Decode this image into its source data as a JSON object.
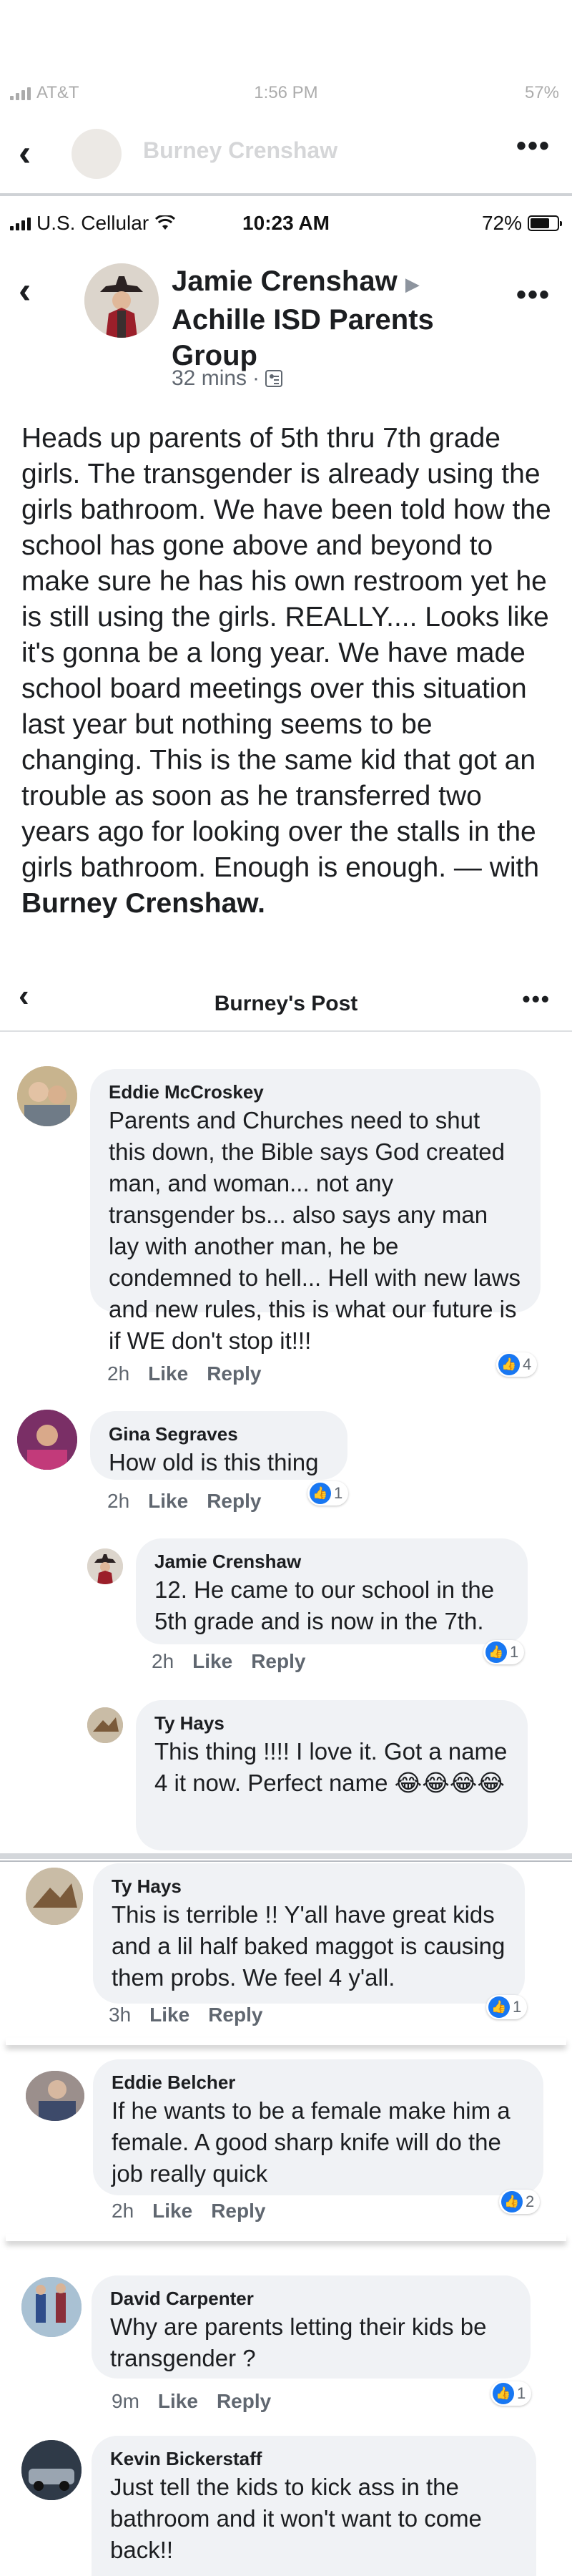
{
  "top_status": {
    "carrier": "AT&T",
    "time": "1:56 PM",
    "battery": "57%"
  },
  "top_nav": {
    "title": "Burney Crenshaw"
  },
  "status": {
    "carrier": "U.S. Cellular",
    "time": "10:23 AM",
    "battery": "72%",
    "battery_level": 0.72
  },
  "post": {
    "author": "Jamie Crenshaw",
    "group": "Achille ISD Parents Group",
    "time": "32 mins",
    "body": "Heads up parents of 5th thru 7th grade girls. The transgender is already using the girls bathroom. We have been told how the school has gone above and beyond to make sure he has his own restroom yet he is still using the girls. REALLY.... Looks like it's gonna be a long year. We have made school board meetings over this situation last year but nothing seems to be changing. This is the same kid that got an trouble as soon as he transferred two years ago for looking over the stalls in the girls bathroom. Enough is enough. — with",
    "tagged": "Burney Crenshaw."
  },
  "post_header": {
    "title": "Burney's Post"
  },
  "actions": {
    "like": "Like",
    "reply": "Reply"
  },
  "comments": [
    {
      "name": "Eddie McCroskey",
      "text": "Parents and Churches need to shut this down, the Bible says God created man, and woman... not any transgender bs... also says any man lay with another man, he be condemned to hell... Hell with new laws and new rules, this is what our future is if WE don't stop it!!!",
      "time": "2h",
      "likes": "4"
    },
    {
      "name": "Gina Segraves",
      "text": "How old is this thing",
      "time": "2h",
      "likes": "1"
    },
    {
      "name": "Jamie Crenshaw",
      "text": "12. He came to our school in the 5th grade and is now in the 7th.",
      "time": "2h",
      "likes": "1"
    },
    {
      "name": "Ty Hays",
      "text": "This thing !!!!   I love it.   Got a name 4 it now.  Perfect name 😂😂😂😂",
      "time": "",
      "likes": ""
    },
    {
      "name": "Ty Hays",
      "text": "This is terrible !!    Y'all have great kids and a lil half baked maggot is causing them probs.    We feel 4 y'all.",
      "time": "3h",
      "likes": "1"
    },
    {
      "name": "Eddie Belcher",
      "text": "If he wants to be a female make him a female. A good sharp knife will do the job really quick",
      "time": "2h",
      "likes": "2"
    },
    {
      "name": "David Carpenter",
      "text": "Why are parents letting their kids be transgender ?",
      "time": "9m",
      "likes": "1"
    },
    {
      "name": "Kevin Bickerstaff",
      "text": "Just tell the kids to kick ass in the bathroom and it won't want to come back!!",
      "time": "",
      "likes": ""
    }
  ],
  "colors": {
    "like_blue": "#1877f2",
    "bubble": "#f0f2f5",
    "meta_gray": "#606770"
  },
  "icons": [
    "back-chevron-icon",
    "more-dots-icon",
    "wifi-icon",
    "signal-icon",
    "battery-icon",
    "group-icon",
    "like-thumb-icon"
  ]
}
